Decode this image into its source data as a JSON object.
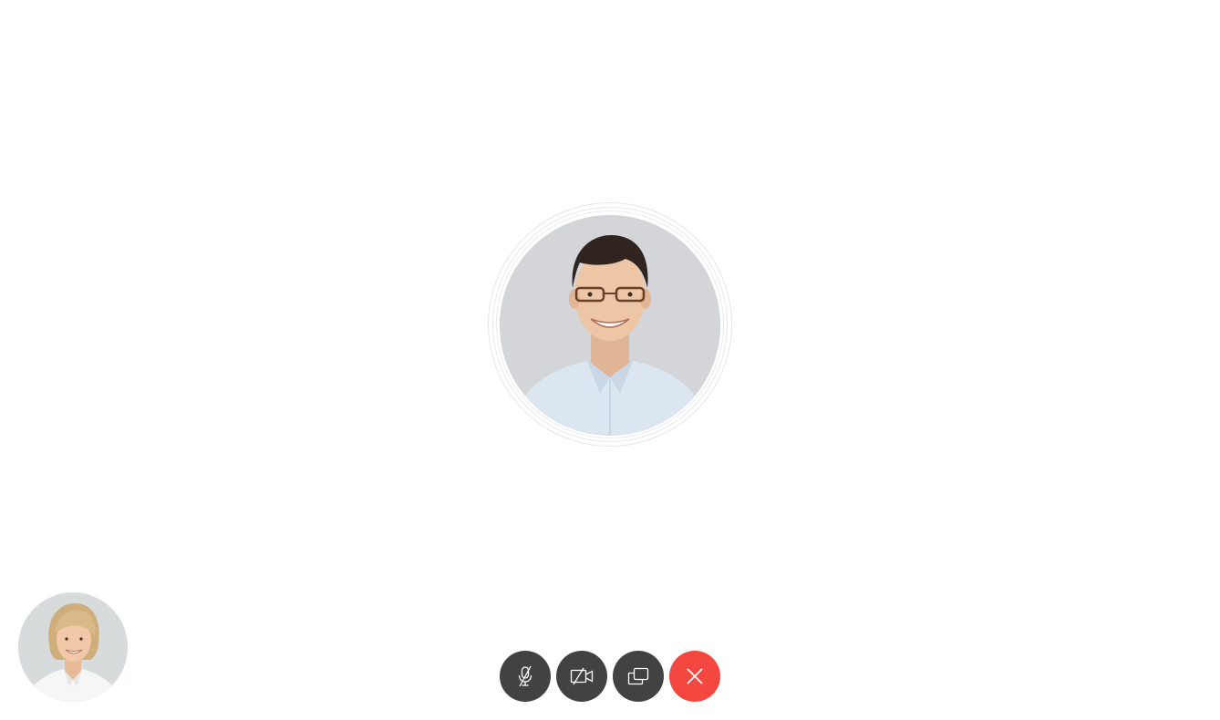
{
  "call": {
    "remote_participant": {
      "avatar_icon": "person-photo",
      "ring_color": "#e6e6e6"
    },
    "self_view": {
      "avatar_icon": "person-photo"
    },
    "controls": [
      {
        "icon": "mic-off-icon",
        "color": "#424242"
      },
      {
        "icon": "video-off-icon",
        "color": "#424242"
      },
      {
        "icon": "screen-share-icon",
        "color": "#424242"
      },
      {
        "icon": "close-icon",
        "color": "#f4473f"
      }
    ]
  }
}
